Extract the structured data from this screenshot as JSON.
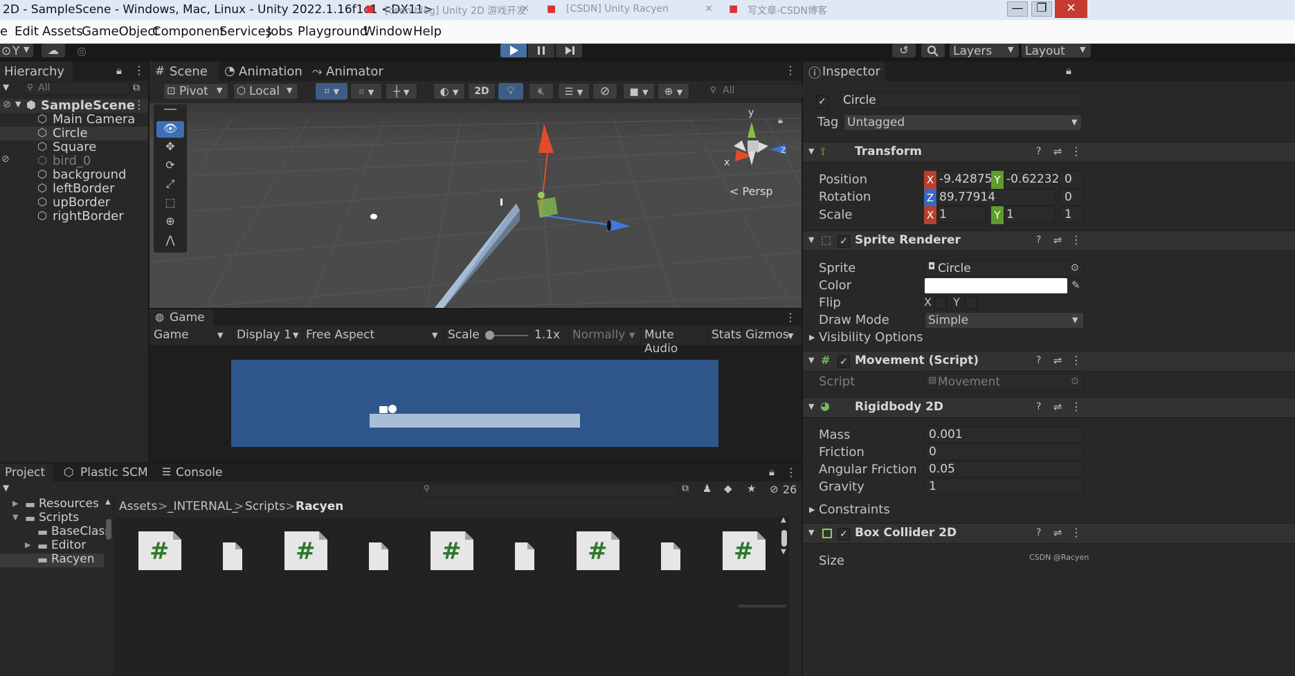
{
  "window": {
    "title": "2D - SampleScene - Windows, Mac, Linux - Unity 2022.1.16f1c1 <DX11>",
    "browser_tabs": [
      "[csdn blog] Unity 2D 游戏开发",
      "[CSDN] Unity Racyen",
      "写文章-CSDN博客"
    ]
  },
  "menu": [
    "e",
    "Edit",
    "Assets",
    "GameObject",
    "Component",
    "Services",
    "Jobs",
    "Playground",
    "Window",
    "Help"
  ],
  "toolbar": {
    "account": "Y",
    "layers": "Layers",
    "layout": "Layout"
  },
  "hierarchy": {
    "tab": "Hierarchy",
    "search_placeholder": "All",
    "scene": "SampleScene",
    "items": [
      "Main Camera",
      "Circle",
      "Square",
      "bird_0",
      "background",
      "leftBorder",
      "upBorder",
      "rightBorder"
    ]
  },
  "scene_tabs": [
    "Scene",
    "Animation",
    "Animator"
  ],
  "scene_toolbar": {
    "pivot": "Pivot",
    "local": "Local",
    "mode_2d": "2D",
    "search_placeholder": "All"
  },
  "gizmo": {
    "y": "y",
    "x": "x",
    "z": "z",
    "persp": "< Persp"
  },
  "game": {
    "tab": "Game",
    "view": "Game",
    "display": "Display 1",
    "aspect": "Free Aspect",
    "scale_label": "Scale",
    "scale_value": "1.1x",
    "normally": "Normally",
    "mute": "Mute Audio",
    "stats": "Stats",
    "gizmos": "Gizmos"
  },
  "bottom": {
    "tabs": [
      "Project",
      "Plastic SCM",
      "Console"
    ],
    "hidden_count": "26",
    "tree": [
      "Resources",
      "Scripts",
      "BaseClass",
      "Editor",
      "Racyen"
    ],
    "breadcrumb": [
      "Assets",
      ">",
      "_INTERNAL_",
      ">",
      "Scripts",
      ">",
      "Racyen"
    ]
  },
  "inspector": {
    "tab": "Inspector",
    "name": "Circle",
    "tag_label": "Tag",
    "tag": "Untagged",
    "transform": {
      "title": "Transform",
      "position_label": "Position",
      "pos_x": "-9.42875",
      "pos_y": "-0.62232",
      "pos_z": "0",
      "rotation_label": "Rotation",
      "rot_z": "89.77914",
      "rot_extra": "0",
      "scale_label": "Scale",
      "sc_x": "1",
      "sc_y": "1",
      "sc_z": "1"
    },
    "sprite": {
      "title": "Sprite Renderer",
      "sprite_label": "Sprite",
      "sprite": "Circle",
      "color_label": "Color",
      "flip_label": "Flip",
      "flip_x": "X",
      "flip_y": "Y",
      "draw_label": "Draw Mode",
      "draw": "Simple",
      "visibility": "Visibility Options"
    },
    "movement": {
      "title": "Movement (Script)",
      "script_label": "Script",
      "script": "Movement"
    },
    "rigidbody": {
      "title": "Rigidbody 2D",
      "mass_label": "Mass",
      "mass": "0.001",
      "friction_label": "Friction",
      "friction": "0",
      "angular_label": "Angular Friction",
      "angular": "0.05",
      "gravity_label": "Gravity",
      "gravity": "1",
      "constraints": "Constraints"
    },
    "box": {
      "title": "Box Collider 2D",
      "size_label": "Size"
    }
  },
  "watermark": "CSDN @Racyen",
  "colors": {
    "accent": "#3d6fb4",
    "game_bg": "#2f568a",
    "play_active": "#476fa1"
  }
}
